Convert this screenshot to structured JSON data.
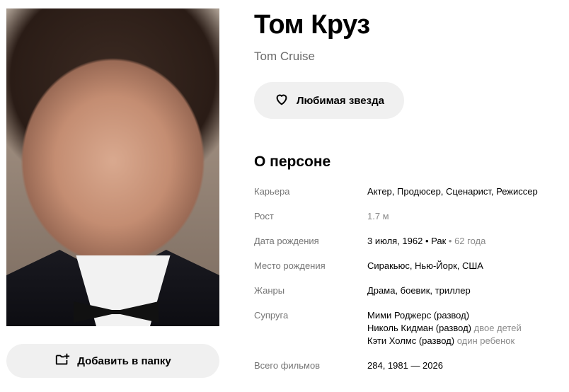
{
  "person": {
    "name": "Том Круз",
    "original_name": "Tom Cruise"
  },
  "actions": {
    "favorite_label": "Любимая звезда",
    "add_folder_label": "Добавить в папку"
  },
  "icons": {
    "favorite": "heart-icon",
    "add_folder": "folder-add-icon"
  },
  "about": {
    "title": "О персоне",
    "career": {
      "label": "Карьера",
      "value": "Актер, Продюсер, Сценарист, Режиссер"
    },
    "height": {
      "label": "Рост",
      "value": "1.7 м"
    },
    "birth": {
      "label": "Дата рождения",
      "date": "3 июля, 1962",
      "sep1": " • ",
      "sign": "Рак",
      "sep2": " • ",
      "age": "62 года"
    },
    "birthplace": {
      "label": "Место рождения",
      "value": "Сиракьюс, Нью-Йорк, США"
    },
    "genres": {
      "label": "Жанры",
      "value": "Драма, боевик, триллер"
    },
    "spouse": {
      "label": "Супруга",
      "items": [
        {
          "name": "Мими Роджерс (развод)",
          "note": ""
        },
        {
          "name": "Николь Кидман (развод)",
          "note": "двое детей"
        },
        {
          "name": "Кэти Холмс (развод)",
          "note": "один ребенок"
        }
      ]
    },
    "films": {
      "label": "Всего фильмов",
      "value": "284, 1981 — 2026"
    }
  },
  "colors": {
    "button_bg": "#f0f0f0",
    "label_gray": "#757575",
    "muted_gray": "#8a8a8a"
  }
}
